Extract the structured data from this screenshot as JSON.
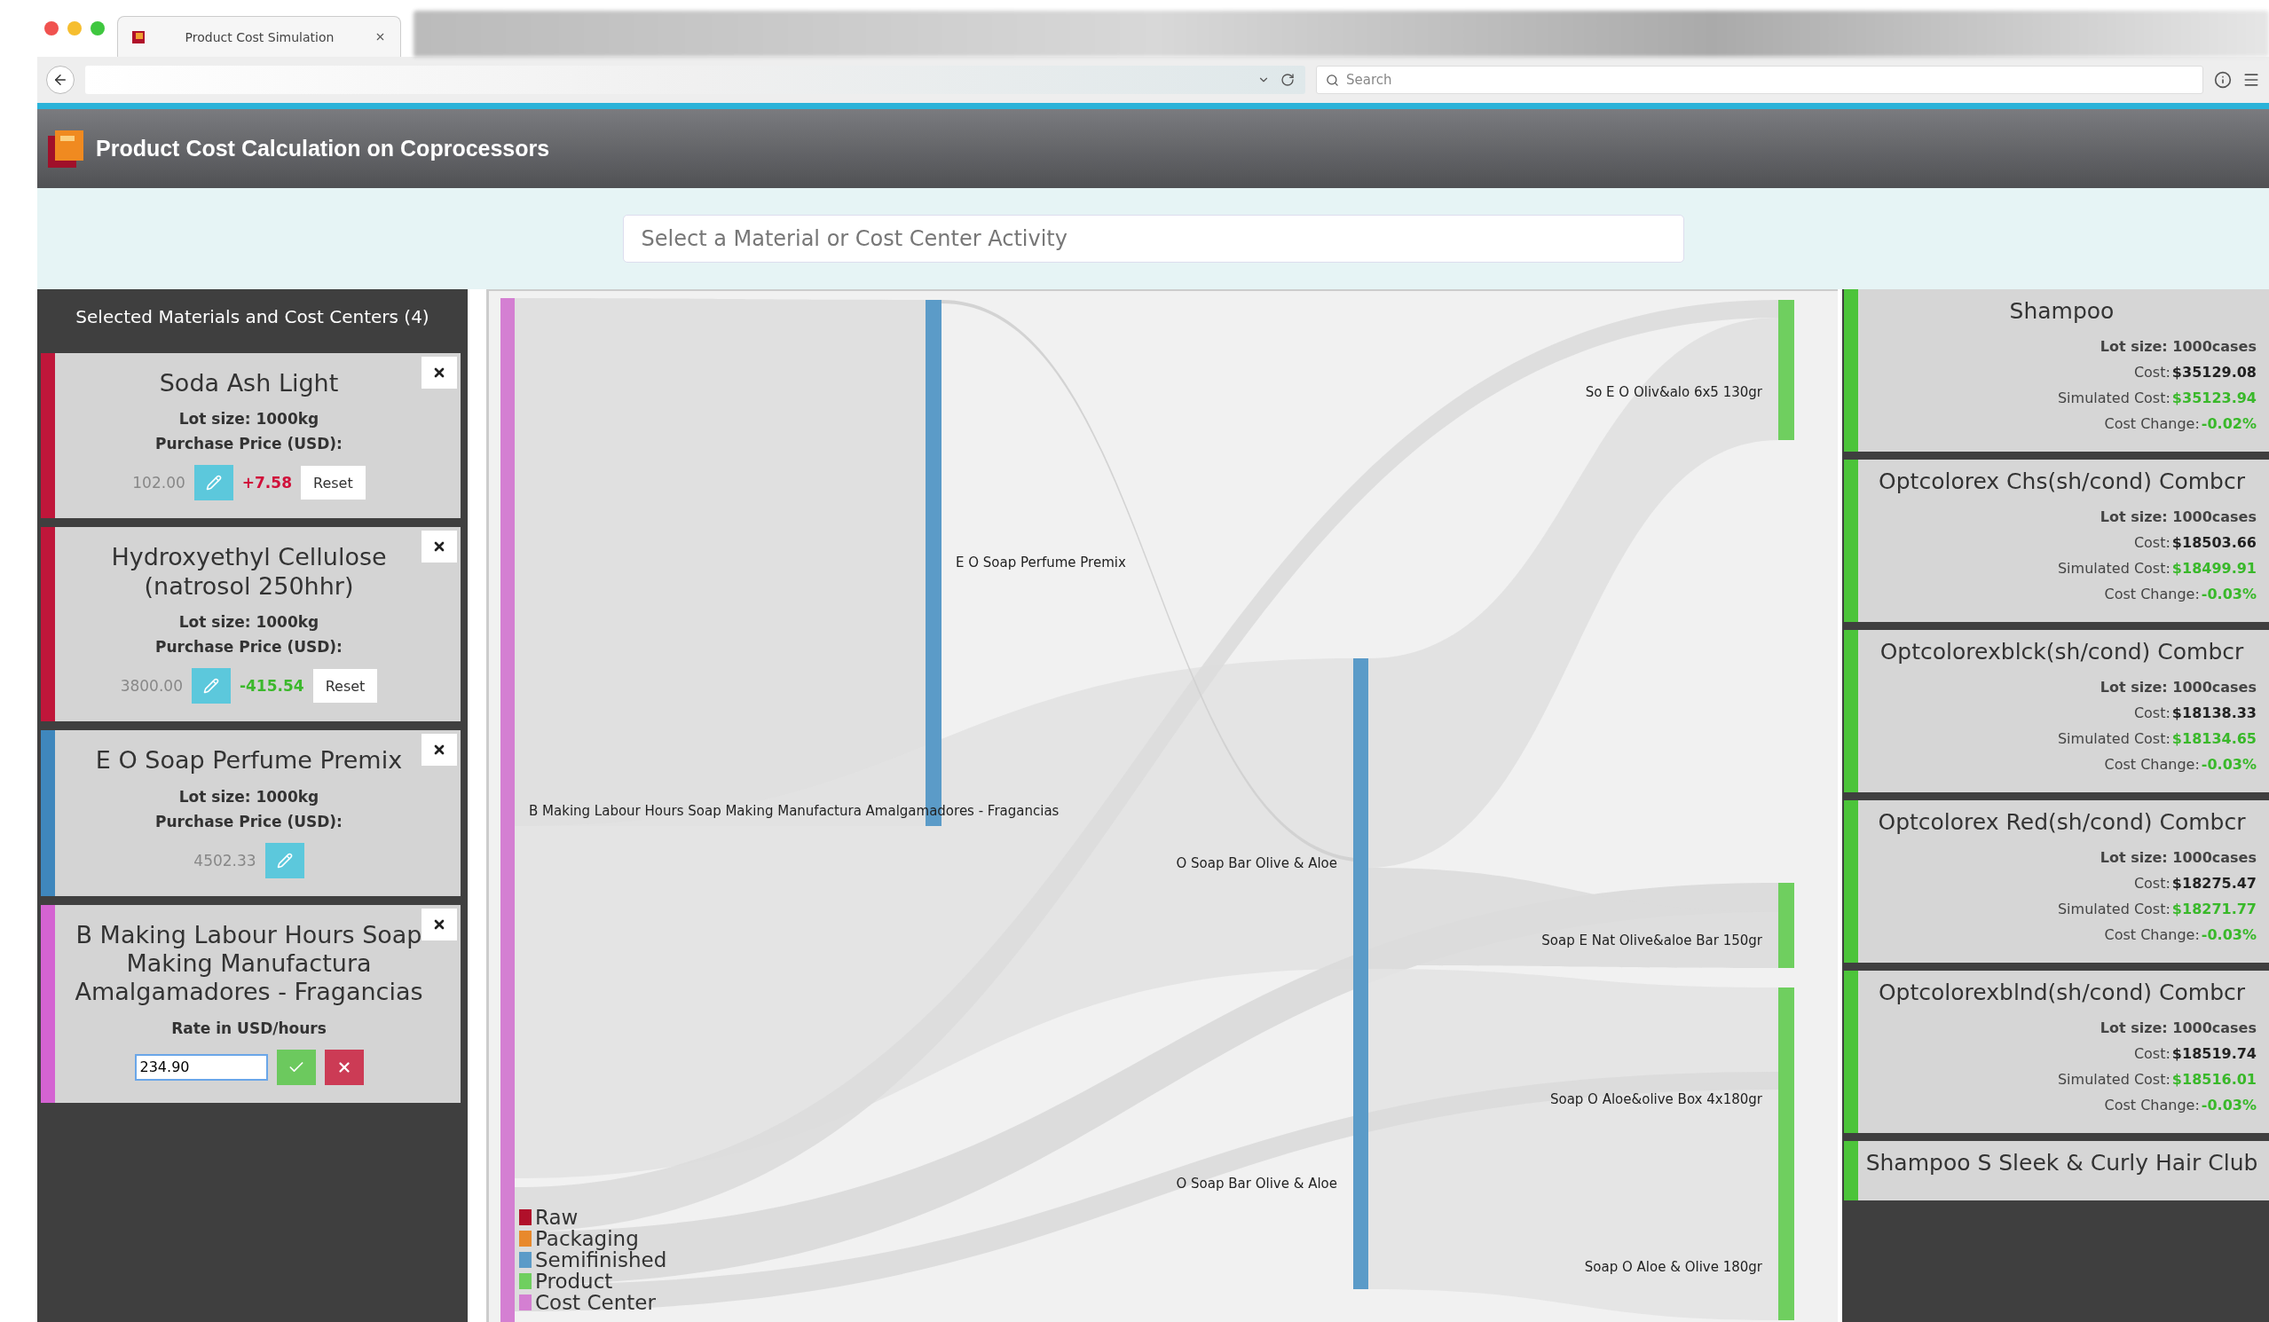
{
  "browser": {
    "tab_title": "Product Cost Simulation",
    "search_placeholder": "Search"
  },
  "app": {
    "title": "Product Cost Calculation on Coprocessors"
  },
  "search": {
    "placeholder": "Select a Material or Cost Center Activity"
  },
  "selected_panel": {
    "title": "Selected Materials and Cost Centers (4)",
    "items": [
      {
        "kind": "material",
        "name": "Soda Ash Light",
        "color": "#c0163a",
        "lot_size": "Lot size: 1000kg",
        "price_label": "Purchase Price (USD):",
        "price": "102.00",
        "delta": "+7.58",
        "price_increased": true,
        "reset": "Reset"
      },
      {
        "kind": "material",
        "name": "Hydroxyethyl Cellulose (natrosol 250hhr)",
        "color": "#c0163a",
        "lot_size": "Lot size: 1000kg",
        "price_label": "Purchase Price (USD):",
        "price": "3800.00",
        "delta": "-415.54",
        "price_increased": false,
        "reset": "Reset"
      },
      {
        "kind": "material",
        "name": "E O Soap Perfume Premix",
        "color": "#3f87bd",
        "lot_size": "Lot size: 1000kg",
        "price_label": "Purchase Price (USD):",
        "price": "4502.33"
      },
      {
        "kind": "cost_center",
        "name": "B Making Labour Hours Soap Making Manufactura Amalgamadores - Fragancias",
        "color": "#d463d2",
        "rate_label": "Rate in USD/hours",
        "value": "234.90"
      }
    ]
  },
  "sankey": {
    "nodes": [
      {
        "label": "B Making Labour Hours Soap Making Manufactura Amalgamadores - Fragancias",
        "color": "#d47fd2"
      },
      {
        "label": "E O Soap Perfume Premix",
        "color": "#5b9bc8"
      },
      {
        "label": "O Soap Bar Olive & Aloe",
        "color": "#5b9bc8"
      },
      {
        "label": "O Soap Bar Olive & Aloe",
        "color": "#5b9bc8"
      },
      {
        "label": "So E O Oliv&alo 6x5 130gr",
        "color": "#6fcf5f"
      },
      {
        "label": "Soap E Nat Olive&aloe Bar 150gr",
        "color": "#6fcf5f"
      },
      {
        "label": "Soap O Aloe&olive Box 4x180gr",
        "color": "#6fcf5f"
      },
      {
        "label": "Soap O Aloe & Olive 180gr",
        "color": "#6fcf5f"
      }
    ],
    "legend": [
      {
        "label": "Raw",
        "color": "#b0102a"
      },
      {
        "label": "Packaging",
        "color": "#e8892c"
      },
      {
        "label": "Semifinished",
        "color": "#5b9bc8"
      },
      {
        "label": "Product",
        "color": "#6fcf5f"
      },
      {
        "label": "Cost Center",
        "color": "#d47fd2"
      }
    ]
  },
  "products": [
    {
      "name": "Shampoo",
      "color": "#4cc43a",
      "lot_size": "Lot size: 1000cases",
      "cost_label": "Cost:",
      "cost": "$35129.08",
      "simulated_label": "Simulated Cost:",
      "simulated_cost": "$35123.94",
      "change_label": "Cost Change:",
      "change": "-0.02%"
    },
    {
      "name": "Optcolorex Chs(sh/cond) Combcr",
      "color": "#4cc43a",
      "lot_size": "Lot size: 1000cases",
      "cost_label": "Cost:",
      "cost": "$18503.66",
      "simulated_label": "Simulated Cost:",
      "simulated_cost": "$18499.91",
      "change_label": "Cost Change:",
      "change": "-0.03%"
    },
    {
      "name": "Optcolorexblck(sh/cond) Combcr",
      "color": "#4cc43a",
      "lot_size": "Lot size: 1000cases",
      "cost_label": "Cost:",
      "cost": "$18138.33",
      "simulated_label": "Simulated Cost:",
      "simulated_cost": "$18134.65",
      "change_label": "Cost Change:",
      "change": "-0.03%"
    },
    {
      "name": "Optcolorex Red(sh/cond) Combcr",
      "color": "#4cc43a",
      "lot_size": "Lot size: 1000cases",
      "cost_label": "Cost:",
      "cost": "$18275.47",
      "simulated_label": "Simulated Cost:",
      "simulated_cost": "$18271.77",
      "change_label": "Cost Change:",
      "change": "-0.03%"
    },
    {
      "name": "Optcolorexblnd(sh/cond) Combcr",
      "color": "#4cc43a",
      "lot_size": "Lot size: 1000cases",
      "cost_label": "Cost:",
      "cost": "$18519.74",
      "simulated_label": "Simulated Cost:",
      "simulated_cost": "$18516.01",
      "change_label": "Cost Change:",
      "change": "-0.03%"
    },
    {
      "name": "Shampoo S Sleek & Curly Hair Club",
      "color": "#4cc43a"
    }
  ]
}
